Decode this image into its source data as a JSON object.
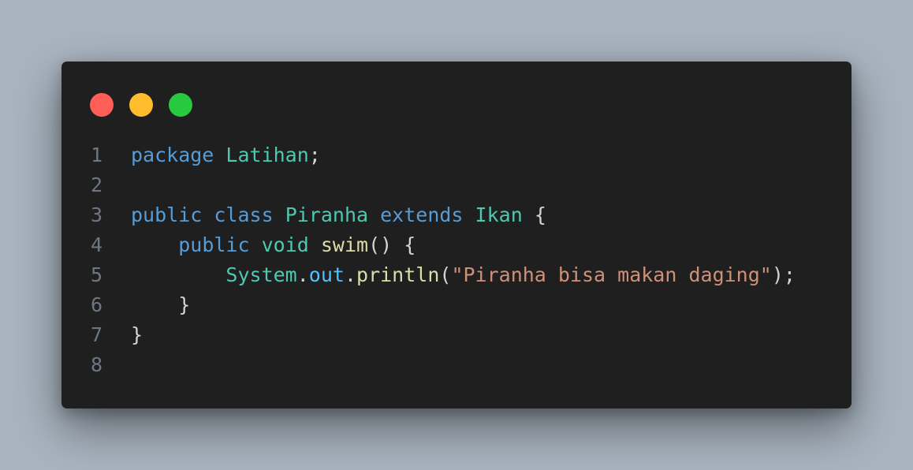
{
  "window": {
    "buttons": [
      {
        "name": "close",
        "color": "#ff5f56"
      },
      {
        "name": "minimize",
        "color": "#ffbd2e"
      },
      {
        "name": "maximize",
        "color": "#27c93f"
      }
    ]
  },
  "code": {
    "lines": [
      {
        "number": "1",
        "tokens": [
          {
            "text": "package",
            "kind": "kw"
          },
          {
            "text": " ",
            "kind": "pn"
          },
          {
            "text": "Latihan",
            "kind": "ty"
          },
          {
            "text": ";",
            "kind": "pn"
          }
        ]
      },
      {
        "number": "2",
        "tokens": []
      },
      {
        "number": "3",
        "tokens": [
          {
            "text": "public",
            "kind": "kw"
          },
          {
            "text": " ",
            "kind": "pn"
          },
          {
            "text": "class",
            "kind": "kw"
          },
          {
            "text": " ",
            "kind": "pn"
          },
          {
            "text": "Piranha",
            "kind": "ty"
          },
          {
            "text": " ",
            "kind": "pn"
          },
          {
            "text": "extends",
            "kind": "kw"
          },
          {
            "text": " ",
            "kind": "pn"
          },
          {
            "text": "Ikan",
            "kind": "ty"
          },
          {
            "text": " {",
            "kind": "pn"
          }
        ]
      },
      {
        "number": "4",
        "tokens": [
          {
            "text": "    ",
            "kind": "pn"
          },
          {
            "text": "public",
            "kind": "kw"
          },
          {
            "text": " ",
            "kind": "pn"
          },
          {
            "text": "void",
            "kind": "ty"
          },
          {
            "text": " ",
            "kind": "pn"
          },
          {
            "text": "swim",
            "kind": "fn"
          },
          {
            "text": "() {",
            "kind": "pn"
          }
        ]
      },
      {
        "number": "5",
        "tokens": [
          {
            "text": "        ",
            "kind": "pn"
          },
          {
            "text": "System",
            "kind": "ty"
          },
          {
            "text": ".",
            "kind": "pn"
          },
          {
            "text": "out",
            "kind": "var"
          },
          {
            "text": ".",
            "kind": "pn"
          },
          {
            "text": "println",
            "kind": "fn"
          },
          {
            "text": "(",
            "kind": "pn"
          },
          {
            "text": "\"Piranha bisa makan daging\"",
            "kind": "str"
          },
          {
            "text": ");",
            "kind": "pn"
          }
        ]
      },
      {
        "number": "6",
        "tokens": [
          {
            "text": "    }",
            "kind": "pn"
          }
        ]
      },
      {
        "number": "7",
        "tokens": [
          {
            "text": "}",
            "kind": "pn"
          }
        ]
      },
      {
        "number": "8",
        "tokens": []
      }
    ]
  }
}
